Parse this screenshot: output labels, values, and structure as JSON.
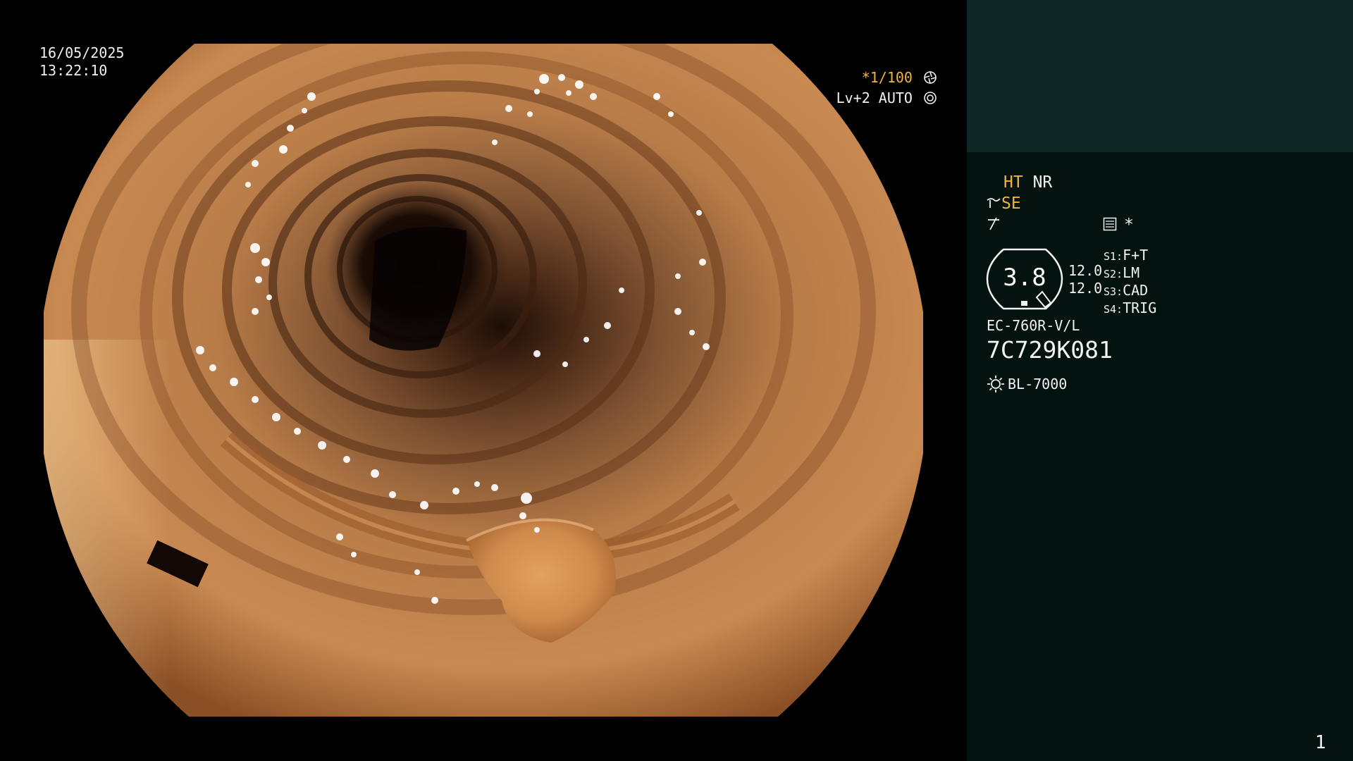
{
  "overlay": {
    "date": "16/05/2025",
    "time": "13:22:10",
    "shutter": "*1/100",
    "shutter_icon": "shutter-wheel-icon",
    "level": "Lv+2 AUTO",
    "level_icon": "auto-iris-icon"
  },
  "panel": {
    "ht_label": "HT",
    "nr_label": "NR",
    "se_label": "SE",
    "se_icon": "structure-enhancement-icon",
    "ce_icon": "color-enhancement-icon",
    "memo_icon": "memo-icon",
    "star_label": "*",
    "iris_value": "3.8",
    "enh_values": [
      "12.0",
      "12.0"
    ],
    "switches": [
      {
        "key": "S1:",
        "value": "F+T"
      },
      {
        "key": "S2:",
        "value": "LM"
      },
      {
        "key": "S3:",
        "value": "CAD"
      },
      {
        "key": "S4:",
        "value": "TRIG"
      }
    ],
    "scope_model": "EC-760R-V/L",
    "scope_serial": "7C729K081",
    "light_icon": "lamp-icon",
    "light_source": "BL-7000",
    "page_number": "1"
  },
  "colors": {
    "panel_bg": "#041210",
    "panel_header_bg": "#0e2624",
    "accent_amber": "#f0b43c",
    "text": "#f2f2f2",
    "video_bg": "#000000"
  }
}
